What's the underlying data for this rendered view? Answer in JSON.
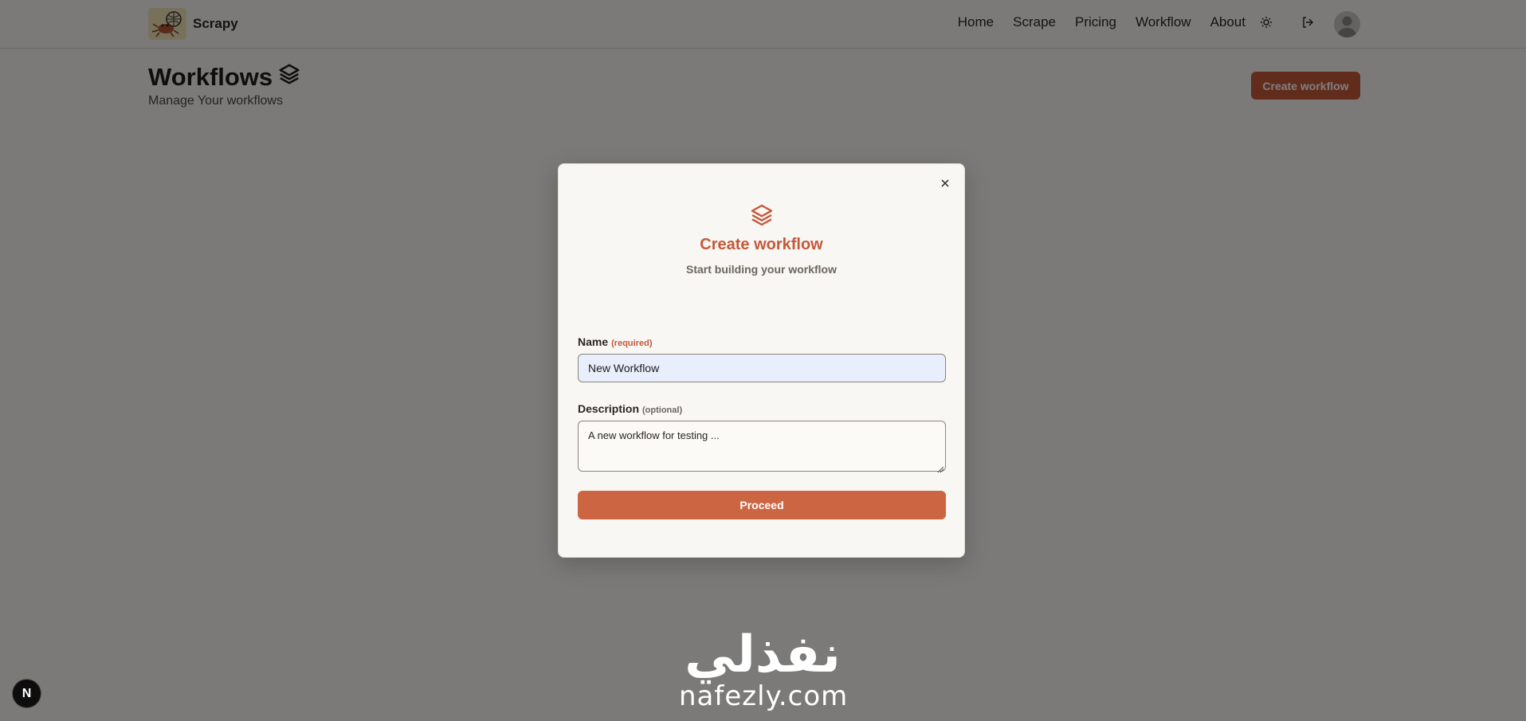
{
  "nav": {
    "brand": "Scrapy",
    "links": [
      "Home",
      "Scrape",
      "Pricing",
      "Workflow",
      "About"
    ],
    "icons": [
      "sun-icon",
      "logout-icon",
      "user-avatar-icon"
    ]
  },
  "header": {
    "title": "Workflows",
    "subtitle": "Manage Your workflows",
    "create_label": "Create workflow"
  },
  "modal": {
    "title": "Create workflow",
    "subtitle": "Start building your workflow",
    "name_label": "Name",
    "name_hint": "(required)",
    "name_value": "New Workflow",
    "description_label": "Description",
    "description_hint": "(optional)",
    "description_value": "A new workflow for testing ...",
    "proceed_label": "Proceed"
  },
  "watermark": {
    "arabic": "نفذلي",
    "latin": "nafezly.com"
  },
  "dev_badge": {
    "label": "N"
  },
  "colors": {
    "accent": "#c4593a",
    "proceed": "#cc6642",
    "overlay": "rgba(0,0,0,0.5)",
    "input_fill": "#e8eefc"
  }
}
